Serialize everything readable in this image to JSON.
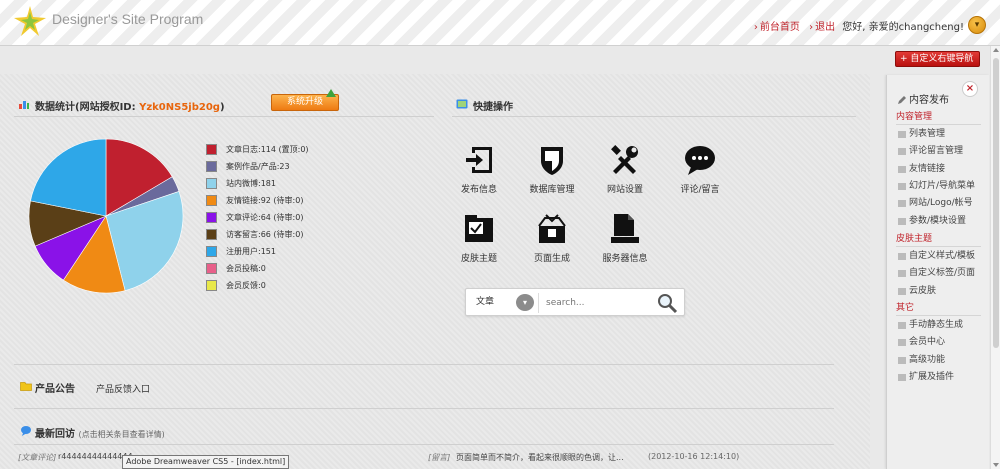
{
  "header": {
    "brand": "Designer's Site Program",
    "nav_home": "前台首页",
    "nav_logout": "退出",
    "greeting": "您好, 亲爱的changcheng!"
  },
  "custom_nav_button": "自定义右键导航",
  "stats": {
    "title_prefix": "数据统计(网站授权ID: ",
    "license_id": "Yzk0NS5jb20g",
    "title_suffix": ")",
    "upgrade_label": "系统升级",
    "legend": [
      {
        "label": "文章日志:114 (置顶:0)",
        "color": "#c0202f"
      },
      {
        "label": "案例作品/产品:23",
        "color": "#6a6a9c"
      },
      {
        "label": "站内微博:181",
        "color": "#8fd2eb"
      },
      {
        "label": "友情链接:92 (待审:0)",
        "color": "#f08a14"
      },
      {
        "label": "文章评论:64 (待审:0)",
        "color": "#8a12e8"
      },
      {
        "label": "访客留言:66 (待审:0)",
        "color": "#5a3f17"
      },
      {
        "label": "注册用户:151",
        "color": "#2ea7e8"
      },
      {
        "label": "会员投稿:0",
        "color": "#e8608a"
      },
      {
        "label": "会员反馈:0",
        "color": "#e8e84a"
      }
    ]
  },
  "chart_data": {
    "type": "pie",
    "categories": [
      "文章日志",
      "案例作品/产品",
      "站内微博",
      "友情链接",
      "文章评论",
      "访客留言",
      "注册用户",
      "会员投稿",
      "会员反馈"
    ],
    "values": [
      114,
      23,
      181,
      92,
      64,
      66,
      151,
      0,
      0
    ],
    "colors": [
      "#c0202f",
      "#6a6a9c",
      "#8fd2eb",
      "#f08a14",
      "#8a12e8",
      "#5a3f17",
      "#2ea7e8",
      "#e8608a",
      "#e8e84a"
    ],
    "title": "",
    "legend": "right"
  },
  "quick": {
    "title": "快捷操作",
    "tiles": [
      {
        "label": "发布信息",
        "icon": "publish-icon"
      },
      {
        "label": "数据库管理",
        "icon": "database-shield-icon"
      },
      {
        "label": "网站设置",
        "icon": "tools-icon"
      },
      {
        "label": "评论/留言",
        "icon": "comment-icon"
      },
      {
        "label": "皮肤主题",
        "icon": "skin-icon"
      },
      {
        "label": "页面生成",
        "icon": "page-generate-icon"
      },
      {
        "label": "服务器信息",
        "icon": "server-icon"
      }
    ],
    "search_select": "文章",
    "search_placeholder": "search..."
  },
  "announcement": {
    "title": "产品公告",
    "link": "产品反馈入口"
  },
  "recent": {
    "title": "最新回访",
    "hint": "(点击相关条目查看详情)",
    "row_left_tag": "[文章评论]",
    "row_left_text": "r44444444444444",
    "row_right_tag": "[留言]",
    "row_right_text": "页面简单而不简介，看起来很顺眼的色调，让...",
    "row_right_time": "(2012-10-16 12:14:10)"
  },
  "tooltip": "Adobe Dreamweaver CS5 - [index.html]",
  "sidebar": {
    "head": "内容发布",
    "cat1": "内容管理",
    "items1": [
      "列表管理",
      "评论留言管理",
      "友情链接",
      "幻灯片/导航菜单",
      "网站/Logo/帐号",
      "参数/模块设置"
    ],
    "cat2": "皮肤主题",
    "items2": [
      "自定义样式/模板",
      "自定义标签/页面",
      "云皮肤"
    ],
    "cat3": "其它",
    "items3": [
      "手动静态生成",
      "会员中心",
      "高级功能",
      "扩展及插件"
    ]
  }
}
